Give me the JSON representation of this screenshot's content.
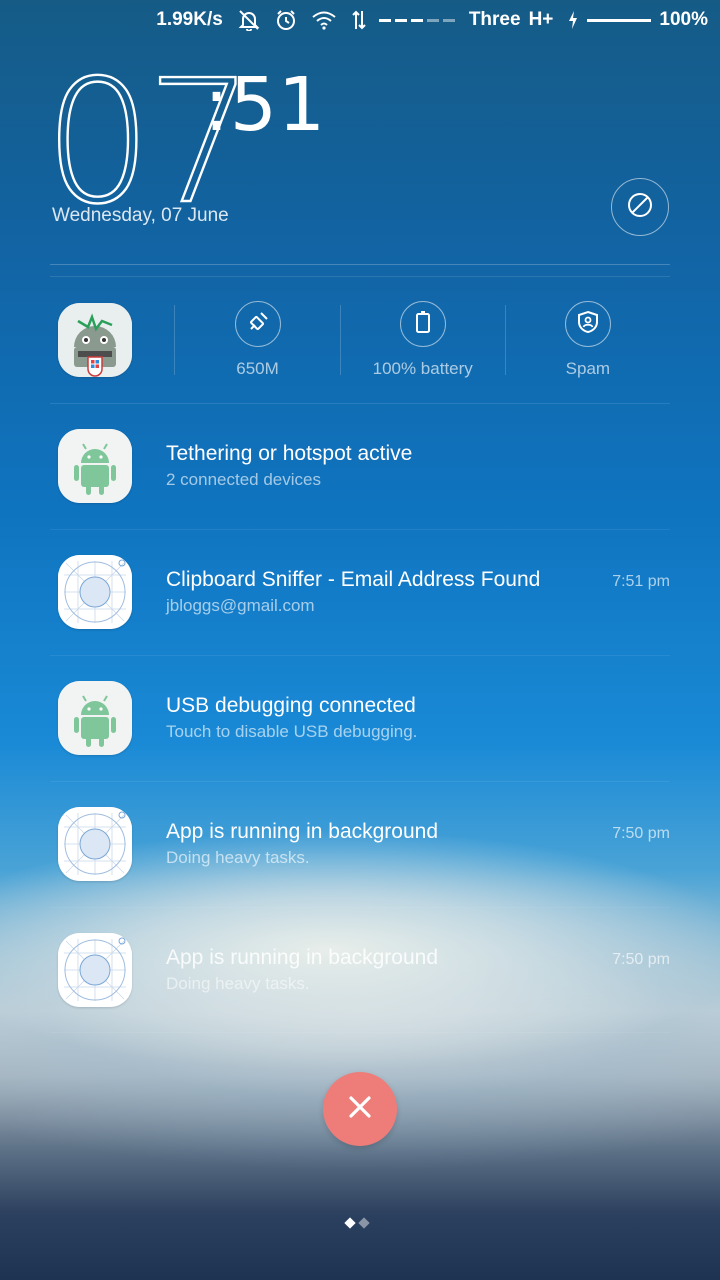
{
  "status_bar": {
    "network_speed": "1.99K/s",
    "carrier": "Three",
    "network_type": "H+",
    "battery": "100%",
    "icons": [
      "muted-bell-icon",
      "alarm-icon",
      "wifi-icon",
      "data-arrows-icon",
      "signal-icon",
      "charging-icon",
      "battery-icon"
    ]
  },
  "clock": {
    "hours": "07",
    "minutes": ":51"
  },
  "date": "Wednesday, 07 June",
  "toolbar": {
    "items": [
      {
        "label": "650M",
        "icon": "broom-icon"
      },
      {
        "label": "100% battery",
        "icon": "battery-icon"
      },
      {
        "label": "Spam",
        "icon": "shield-user-icon"
      }
    ]
  },
  "notifications": [
    {
      "title": "Tethering or hotspot active",
      "subtitle": "2 connected devices",
      "time": "",
      "icon": "android-icon"
    },
    {
      "title": "Clipboard Sniffer - Email Address Found",
      "subtitle": "jbloggs@gmail.com",
      "time": "7:51 pm",
      "icon": "placeholder-app-icon"
    },
    {
      "title": "USB debugging connected",
      "subtitle": "Touch to disable USB debugging.",
      "time": "",
      "icon": "android-icon"
    },
    {
      "title": "App is running in background",
      "subtitle": "Doing heavy tasks.",
      "time": "7:50 pm",
      "icon": "placeholder-app-icon"
    },
    {
      "title": "App is running in background",
      "subtitle": "Doing heavy tasks.",
      "time": "7:50 pm",
      "icon": "placeholder-app-icon"
    }
  ],
  "colors": {
    "clear_button": "#ee7d7a",
    "android_green": "#7fc79a"
  }
}
